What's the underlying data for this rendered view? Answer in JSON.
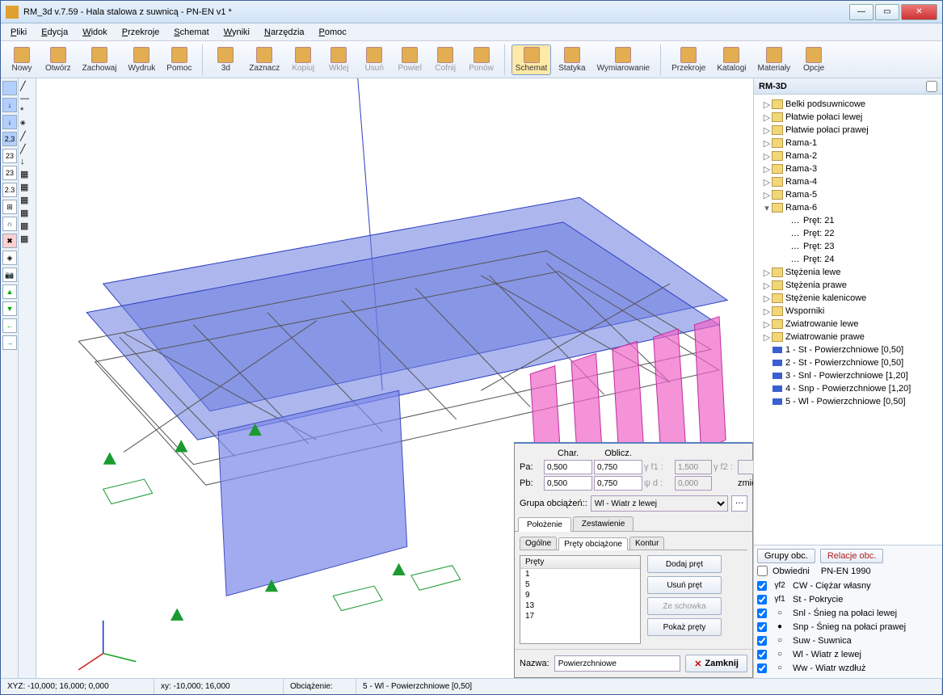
{
  "title": "RM_3d v.7.59 - Hala stalowa z suwnicą - PN-EN v1 *",
  "menu": [
    "Pliki",
    "Edycja",
    "Widok",
    "Przekroje",
    "Schemat",
    "Wyniki",
    "Narzędzia",
    "Pomoc"
  ],
  "toolbar": [
    {
      "label": "Nowy"
    },
    {
      "label": "Otwórz"
    },
    {
      "label": "Zachowaj"
    },
    {
      "label": "Wydruk"
    },
    {
      "label": "Pomoc"
    },
    {
      "sep": true
    },
    {
      "label": "3d"
    },
    {
      "label": "Zaznacz"
    },
    {
      "label": "Kopiuj",
      "dis": true
    },
    {
      "label": "Wklej",
      "dis": true
    },
    {
      "label": "Usuń",
      "dis": true
    },
    {
      "label": "Powiel",
      "dis": true
    },
    {
      "label": "Cofnij",
      "dis": true
    },
    {
      "label": "Ponów",
      "dis": true
    },
    {
      "sep": true
    },
    {
      "label": "Schemat",
      "active": true
    },
    {
      "label": "Statyka"
    },
    {
      "label": "Wymiarowanie"
    },
    {
      "sep": true
    },
    {
      "label": "Przekroje"
    },
    {
      "label": "Katalogi"
    },
    {
      "label": "Materiały"
    },
    {
      "label": "Opcje"
    }
  ],
  "rp_title": "RM-3D",
  "tree": [
    {
      "l": 1,
      "exp": "▷",
      "t": "Belki podsuwnicowe",
      "f": true
    },
    {
      "l": 1,
      "exp": "▷",
      "t": "Płatwie połaci lewej",
      "f": true
    },
    {
      "l": 1,
      "exp": "▷",
      "t": "Płatwie połaci prawej",
      "f": true
    },
    {
      "l": 1,
      "exp": "▷",
      "t": "Rama-1",
      "f": true
    },
    {
      "l": 1,
      "exp": "▷",
      "t": "Rama-2",
      "f": true
    },
    {
      "l": 1,
      "exp": "▷",
      "t": "Rama-3",
      "f": true
    },
    {
      "l": 1,
      "exp": "▷",
      "t": "Rama-4",
      "f": true
    },
    {
      "l": 1,
      "exp": "▷",
      "t": "Rama-5",
      "f": true
    },
    {
      "l": 1,
      "exp": "▾",
      "t": "Rama-6",
      "f": true
    },
    {
      "l": 2,
      "t": "Pręt: 21"
    },
    {
      "l": 2,
      "t": "Pręt: 22"
    },
    {
      "l": 2,
      "t": "Pręt: 23"
    },
    {
      "l": 2,
      "t": "Pręt: 24"
    },
    {
      "l": 1,
      "exp": "▷",
      "t": "Stężenia lewe",
      "f": true
    },
    {
      "l": 1,
      "exp": "▷",
      "t": "Stężenia prawe",
      "f": true
    },
    {
      "l": 1,
      "exp": "▷",
      "t": "Stężenie kalenicowe",
      "f": true
    },
    {
      "l": 1,
      "exp": "▷",
      "t": "Wsporniki",
      "f": true
    },
    {
      "l": 1,
      "exp": "▷",
      "t": "Zwiatrowanie lewe",
      "f": true
    },
    {
      "l": 1,
      "exp": "▷",
      "t": "Zwiatrowanie prawe",
      "f": true
    },
    {
      "l": 1,
      "b": true,
      "t": "1 - St - Powierzchniowe [0,50]"
    },
    {
      "l": 1,
      "b": true,
      "t": "2 - St - Powierzchniowe [0,50]"
    },
    {
      "l": 1,
      "b": true,
      "t": "3 - Snl - Powierzchniowe [1,20]"
    },
    {
      "l": 1,
      "b": true,
      "t": "4 - Snp - Powierzchniowe [1,20]"
    },
    {
      "l": 1,
      "b": true,
      "t": "5 - Wl - Powierzchniowe [0,50]"
    }
  ],
  "groups_btn": "Grupy obc.",
  "rel_btn": "Relacje obc.",
  "obw_label": "Obwiedni",
  "norm_label": "PN-EN 1990",
  "load_cases": [
    {
      "chk": true,
      "sym": "γf2",
      "t": "CW - Ciężar własny"
    },
    {
      "chk": true,
      "sym": "γf1",
      "t": "St - Pokrycie"
    },
    {
      "chk": true,
      "sym": "○",
      "t": "Snl - Śnieg na połaci lewej"
    },
    {
      "chk": true,
      "sym": "●",
      "t": "Snp - Śnieg na połaci prawej"
    },
    {
      "chk": true,
      "sym": "○",
      "t": "Suw - Suwnica"
    },
    {
      "chk": true,
      "sym": "○",
      "t": "Wl - Wiatr z lewej"
    },
    {
      "chk": true,
      "sym": "○",
      "t": "Ww - Wiatr wzdłuż"
    }
  ],
  "load_panel": {
    "char": "Char.",
    "oblicz": "Oblicz.",
    "pa": "Pa:",
    "pa_c": "0,500",
    "pa_o": "0,750",
    "gf1": "γ f1 :",
    "gf1v": "1,500",
    "gf2": "γ f2 :",
    "pb": "Pb:",
    "pb_c": "0,500",
    "pb_o": "0,750",
    "psid": "ψ d :",
    "psidv": "0,000",
    "zm": "zmienne",
    "grupa": "Grupa obciążeń::",
    "grupa_sel": "Wl - Wiatr z lewej",
    "tabs": [
      "Położenie",
      "Zestawienie"
    ],
    "subtabs": [
      "Ogólne",
      "Pręty obciążone",
      "Kontur"
    ],
    "th": "Pręty",
    "rows": [
      "1",
      "5",
      "9",
      "13",
      "17"
    ],
    "btns": [
      "Dodaj pręt",
      "Usuń pręt",
      "Ze schowka",
      "Pokaż pręty"
    ],
    "nazwa": "Nazwa:",
    "nazwa_v": "Powierzchniowe",
    "close": "Zamknij"
  },
  "status": {
    "xyz": "XYZ: -10,000; 16,000; 0,000",
    "xy": "xy: -10,000; 16,000",
    "obc": "Obciążenie:",
    "case": "5 - Wl - Powierzchniowe [0,50]"
  }
}
